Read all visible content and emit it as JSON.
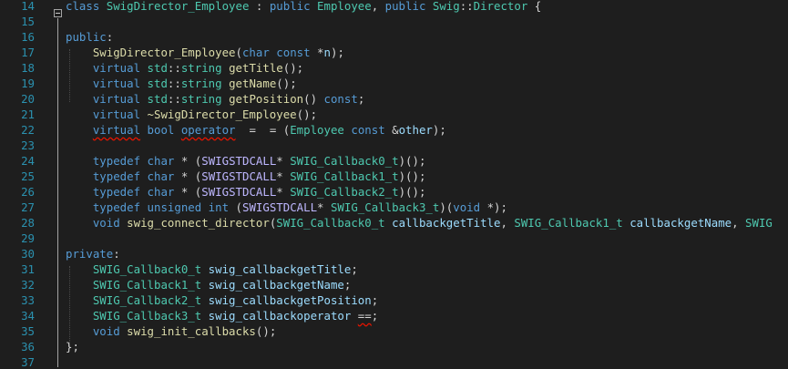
{
  "line_numbers": [
    "14",
    "15",
    "16",
    "17",
    "18",
    "19",
    "20",
    "21",
    "22",
    "23",
    "24",
    "25",
    "26",
    "27",
    "28",
    "29",
    "30",
    "31",
    "32",
    "33",
    "34",
    "35",
    "36",
    "37"
  ],
  "colors": {
    "keyword": "#569cd6",
    "type": "#4ec9b0",
    "function": "#dcdcaa",
    "variable": "#9cdcfe",
    "macro": "#beb7ff",
    "text": "#d4d4d4",
    "line_number": "#2b91af",
    "squiggle": "#e51400"
  },
  "code_lines": [
    [
      [
        "class ",
        "keyword"
      ],
      [
        "SwigDirector_Employee",
        "type"
      ],
      [
        " : ",
        "text"
      ],
      [
        "public ",
        "keyword"
      ],
      [
        "Employee",
        "type"
      ],
      [
        ", ",
        "text"
      ],
      [
        "public ",
        "keyword"
      ],
      [
        "Swig",
        "type"
      ],
      [
        "::",
        "text"
      ],
      [
        "Director",
        "type"
      ],
      [
        " {",
        "text"
      ]
    ],
    [],
    [
      [
        "public",
        "keyword"
      ],
      [
        ":",
        "text"
      ]
    ],
    [
      [
        "    ",
        "text"
      ],
      [
        "SwigDirector_Employee",
        "function"
      ],
      [
        "(",
        "text"
      ],
      [
        "char ",
        "keyword"
      ],
      [
        "const ",
        "keyword"
      ],
      [
        "*",
        "text"
      ],
      [
        "n",
        "variable"
      ],
      [
        ");",
        "text"
      ]
    ],
    [
      [
        "    ",
        "text"
      ],
      [
        "virtual ",
        "keyword"
      ],
      [
        "std",
        "type"
      ],
      [
        "::",
        "text"
      ],
      [
        "string ",
        "type"
      ],
      [
        "getTitle",
        "function"
      ],
      [
        "();",
        "text"
      ]
    ],
    [
      [
        "    ",
        "text"
      ],
      [
        "virtual ",
        "keyword"
      ],
      [
        "std",
        "type"
      ],
      [
        "::",
        "text"
      ],
      [
        "string ",
        "type"
      ],
      [
        "getName",
        "function"
      ],
      [
        "();",
        "text"
      ]
    ],
    [
      [
        "    ",
        "text"
      ],
      [
        "virtual ",
        "keyword"
      ],
      [
        "std",
        "type"
      ],
      [
        "::",
        "text"
      ],
      [
        "string ",
        "type"
      ],
      [
        "getPosition",
        "function"
      ],
      [
        "() ",
        "text"
      ],
      [
        "const",
        "keyword"
      ],
      [
        ";",
        "text"
      ]
    ],
    [
      [
        "    ",
        "text"
      ],
      [
        "virtual ",
        "keyword"
      ],
      [
        "~SwigDirector_Employee",
        "function"
      ],
      [
        "();",
        "text"
      ]
    ],
    [
      [
        "    ",
        "text"
      ],
      [
        "virtual",
        "keyword",
        "sq"
      ],
      [
        " ",
        "text"
      ],
      [
        "bool ",
        "keyword"
      ],
      [
        "operator",
        "keyword",
        "sq"
      ],
      [
        "  =  = ",
        "text"
      ],
      [
        "(",
        "text"
      ],
      [
        "Employee ",
        "type"
      ],
      [
        "const ",
        "keyword"
      ],
      [
        "&",
        "text"
      ],
      [
        "other",
        "variable"
      ],
      [
        ");",
        "text"
      ]
    ],
    [],
    [
      [
        "    ",
        "text"
      ],
      [
        "typedef ",
        "keyword"
      ],
      [
        "char ",
        "keyword"
      ],
      [
        "* (",
        "text"
      ],
      [
        "SWIGSTDCALL",
        "macro"
      ],
      [
        "* ",
        "text"
      ],
      [
        "SWIG_Callback0_t",
        "type"
      ],
      [
        ")();",
        "text"
      ]
    ],
    [
      [
        "    ",
        "text"
      ],
      [
        "typedef ",
        "keyword"
      ],
      [
        "char ",
        "keyword"
      ],
      [
        "* (",
        "text"
      ],
      [
        "SWIGSTDCALL",
        "macro"
      ],
      [
        "* ",
        "text"
      ],
      [
        "SWIG_Callback1_t",
        "type"
      ],
      [
        ")();",
        "text"
      ]
    ],
    [
      [
        "    ",
        "text"
      ],
      [
        "typedef ",
        "keyword"
      ],
      [
        "char ",
        "keyword"
      ],
      [
        "* (",
        "text"
      ],
      [
        "SWIGSTDCALL",
        "macro"
      ],
      [
        "* ",
        "text"
      ],
      [
        "SWIG_Callback2_t",
        "type"
      ],
      [
        ")();",
        "text"
      ]
    ],
    [
      [
        "    ",
        "text"
      ],
      [
        "typedef ",
        "keyword"
      ],
      [
        "unsigned ",
        "keyword"
      ],
      [
        "int ",
        "keyword"
      ],
      [
        "(",
        "text"
      ],
      [
        "SWIGSTDCALL",
        "macro"
      ],
      [
        "* ",
        "text"
      ],
      [
        "SWIG_Callback3_t",
        "type"
      ],
      [
        ")(",
        "text"
      ],
      [
        "void ",
        "keyword"
      ],
      [
        "*);",
        "text"
      ]
    ],
    [
      [
        "    ",
        "text"
      ],
      [
        "void ",
        "keyword"
      ],
      [
        "swig_connect_director",
        "function"
      ],
      [
        "(",
        "text"
      ],
      [
        "SWIG_Callback0_t ",
        "type"
      ],
      [
        "callbackgetTitle",
        "variable"
      ],
      [
        ", ",
        "text"
      ],
      [
        "SWIG_Callback1_t ",
        "type"
      ],
      [
        "callbackgetName",
        "variable"
      ],
      [
        ", ",
        "text"
      ],
      [
        "SWIG",
        "type"
      ]
    ],
    [],
    [
      [
        "private",
        "keyword"
      ],
      [
        ":",
        "text"
      ]
    ],
    [
      [
        "    ",
        "text"
      ],
      [
        "SWIG_Callback0_t ",
        "type"
      ],
      [
        "swig_callbackgetTitle",
        "variable"
      ],
      [
        ";",
        "text"
      ]
    ],
    [
      [
        "    ",
        "text"
      ],
      [
        "SWIG_Callback1_t ",
        "type"
      ],
      [
        "swig_callbackgetName",
        "variable"
      ],
      [
        ";",
        "text"
      ]
    ],
    [
      [
        "    ",
        "text"
      ],
      [
        "SWIG_Callback2_t ",
        "type"
      ],
      [
        "swig_callbackgetPosition",
        "variable"
      ],
      [
        ";",
        "text"
      ]
    ],
    [
      [
        "    ",
        "text"
      ],
      [
        "SWIG_Callback3_t ",
        "type"
      ],
      [
        "swig_callbackoperator ",
        "variable"
      ],
      [
        "==",
        "text",
        "sq"
      ],
      [
        ";",
        "text"
      ]
    ],
    [
      [
        "    ",
        "text"
      ],
      [
        "void ",
        "keyword"
      ],
      [
        "swig_init_callbacks",
        "function"
      ],
      [
        "();",
        "text"
      ]
    ],
    [
      [
        "};",
        "text"
      ]
    ],
    []
  ]
}
